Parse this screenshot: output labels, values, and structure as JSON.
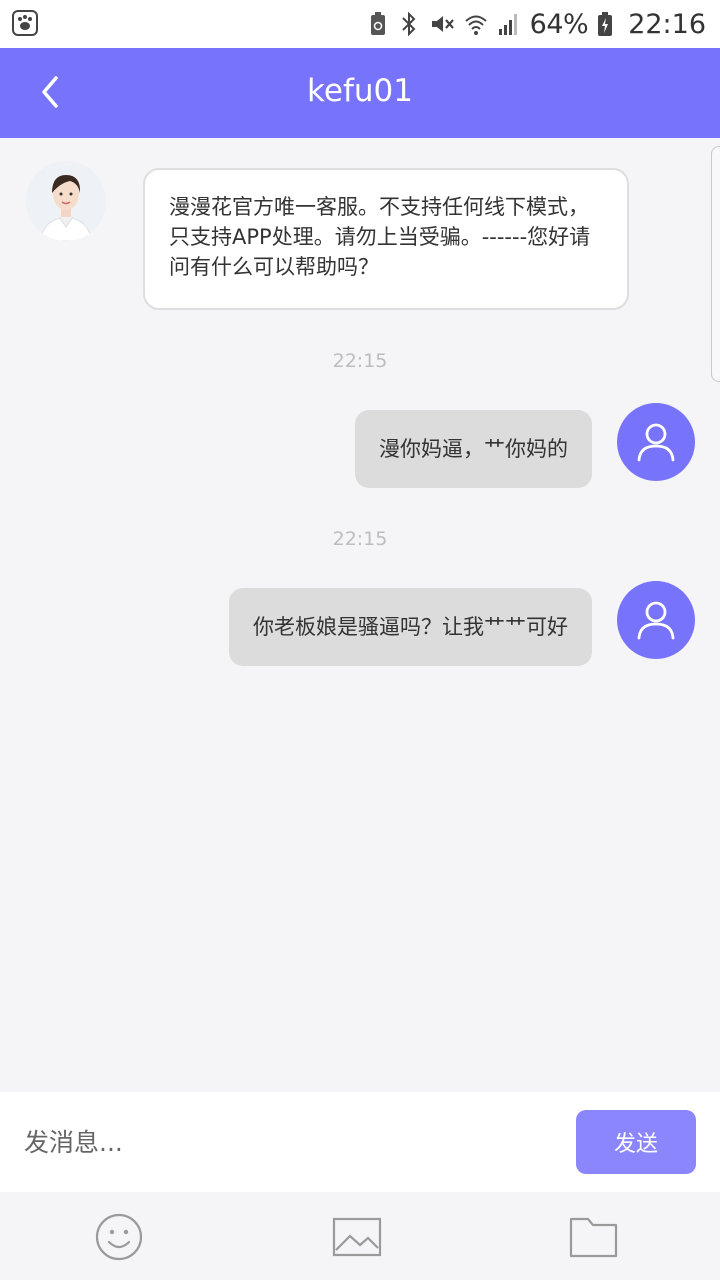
{
  "status_bar": {
    "battery_percent": "64%",
    "time": "22:16",
    "icons": [
      "baidu-paw-icon",
      "recycle-battery-icon",
      "bluetooth-icon",
      "mute-icon",
      "wifi-icon",
      "signal-icon",
      "battery-charging-icon"
    ]
  },
  "header": {
    "title": "kefu01",
    "back_icon": "chevron-left-icon"
  },
  "messages": [
    {
      "sender": "agent",
      "text": "漫漫花官方唯一客服。不支持任何线下模式，只支持APP处理。请勿上当受骗。------您好请问有什么可以帮助吗？"
    },
    {
      "timestamp": "22:15",
      "sender": "user",
      "text": "漫你妈逼，艹你妈的"
    },
    {
      "timestamp": "22:15",
      "sender": "user",
      "text": "你老板娘是骚逼吗？让我艹艹可好"
    }
  ],
  "input": {
    "placeholder": "发消息...",
    "value": "",
    "send_label": "发送"
  },
  "toolbar": {
    "items": [
      "emoji-icon",
      "image-icon",
      "folder-icon"
    ]
  },
  "colors": {
    "accent": "#7873fb",
    "send_button": "#8b86fb",
    "user_bubble": "#dcdcdc",
    "background": "#f5f5f7"
  }
}
